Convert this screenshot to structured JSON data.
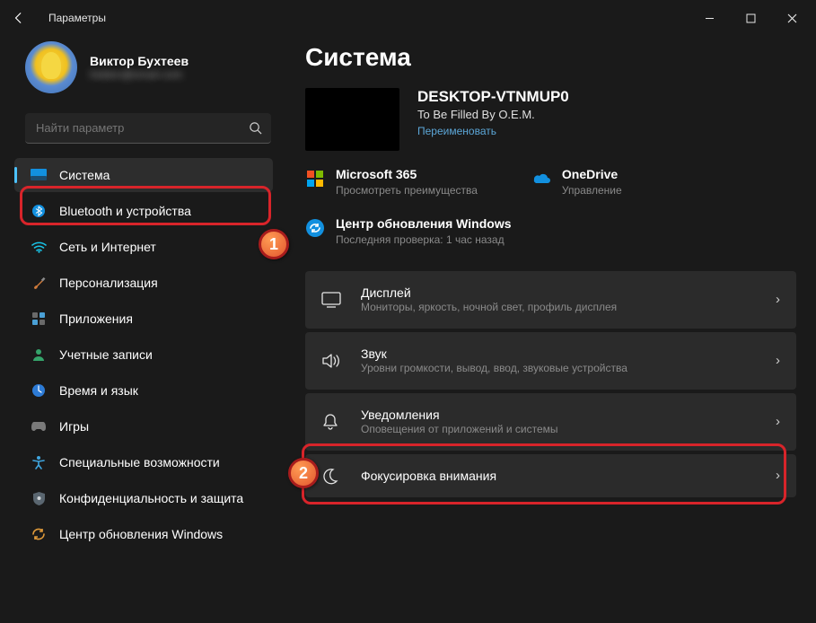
{
  "titlebar": {
    "title": "Параметры"
  },
  "profile": {
    "name": "Виктор Бухтеев",
    "email": "hidden@email.com"
  },
  "search": {
    "placeholder": "Найти параметр"
  },
  "sidebar": {
    "items": [
      {
        "label": "Система"
      },
      {
        "label": "Bluetooth и устройства"
      },
      {
        "label": "Сеть и Интернет"
      },
      {
        "label": "Персонализация"
      },
      {
        "label": "Приложения"
      },
      {
        "label": "Учетные записи"
      },
      {
        "label": "Время и язык"
      },
      {
        "label": "Игры"
      },
      {
        "label": "Специальные возможности"
      },
      {
        "label": "Конфиденциальность и защита"
      },
      {
        "label": "Центр обновления Windows"
      }
    ]
  },
  "page": {
    "title": "Система"
  },
  "device": {
    "name": "DESKTOP-VTNMUP0",
    "oem": "To Be Filled By O.E.M.",
    "rename": "Переименовать"
  },
  "info": {
    "ms365": {
      "title": "Microsoft 365",
      "sub": "Просмотреть преимущества"
    },
    "onedrive": {
      "title": "OneDrive",
      "sub": "Управление"
    },
    "update": {
      "title": "Центр обновления Windows",
      "sub": "Последняя проверка: 1 час назад"
    }
  },
  "settings": [
    {
      "title": "Дисплей",
      "sub": "Мониторы, яркость, ночной свет, профиль дисплея"
    },
    {
      "title": "Звук",
      "sub": "Уровни громкости, вывод, ввод, звуковые устройства"
    },
    {
      "title": "Уведомления",
      "sub": "Оповещения от приложений и системы"
    },
    {
      "title": "Фокусировка внимания",
      "sub": ""
    }
  ]
}
